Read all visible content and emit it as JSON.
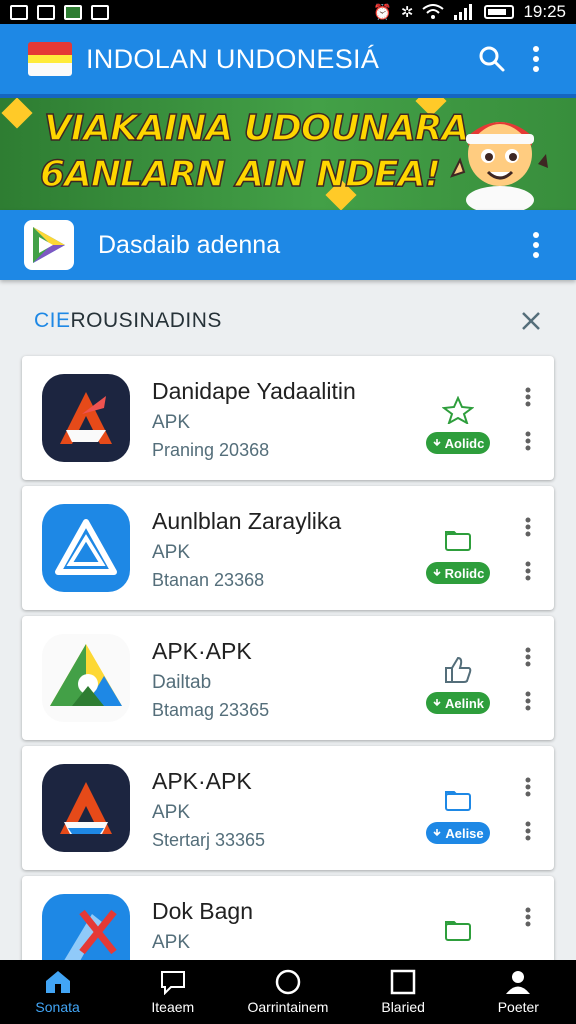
{
  "status_bar": {
    "time": "19:25"
  },
  "app_bar": {
    "title": "INDOLAN UNDONESIÁ"
  },
  "banner": {
    "line1": "VIAKAINA UDOUNARA",
    "line2": "6ANLARN AIN NDEA!"
  },
  "promo": {
    "label": "Dasdaib adenna"
  },
  "section": {
    "title_accent": "CIE",
    "title_rest": "ROUSINADINS"
  },
  "apps": [
    {
      "name": "Danidape Yadaalitin",
      "type": "APK",
      "meta": "Praning 20368",
      "install_label": "Aolidc"
    },
    {
      "name": "Aunlblan Zaraylika",
      "type": "APK",
      "meta": "Btanan 23368",
      "install_label": "Rolidc"
    },
    {
      "name": "APK·APK",
      "type": "Dailtab",
      "meta": "Btamag 23365",
      "install_label": "Aelink"
    },
    {
      "name": "APK·APK",
      "type": "APK",
      "meta": "Stertarj 33365",
      "install_label": "Aelise"
    },
    {
      "name": "Dok Bagn",
      "type": "APK",
      "meta": "",
      "install_label": ""
    }
  ],
  "bottom_nav": [
    {
      "label": "Sonata",
      "icon": "home-icon"
    },
    {
      "label": "Iteaem",
      "icon": "chat-icon"
    },
    {
      "label": "Oarrintainem",
      "icon": "circle-icon"
    },
    {
      "label": "Blaried",
      "icon": "square-icon"
    },
    {
      "label": "Poeter",
      "icon": "profile-icon"
    }
  ],
  "colors": {
    "primary": "#1e88e5",
    "install_green": "#2e9e3c",
    "banner_green": "#43a047",
    "banner_text": "#ffd600"
  }
}
